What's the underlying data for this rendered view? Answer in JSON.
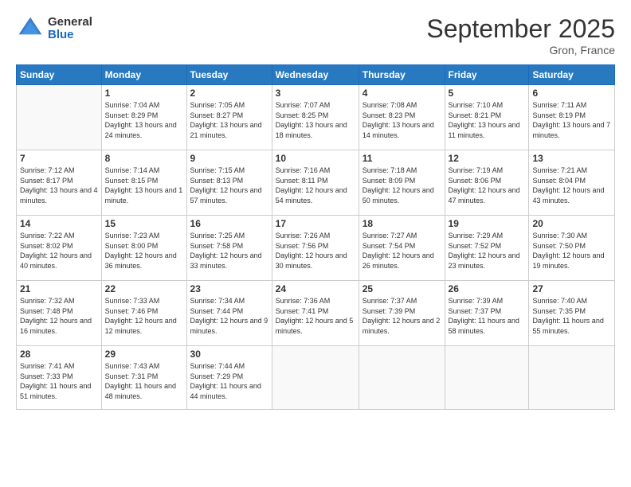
{
  "header": {
    "logo_general": "General",
    "logo_blue": "Blue",
    "month_title": "September 2025",
    "location": "Gron, France"
  },
  "days_of_week": [
    "Sunday",
    "Monday",
    "Tuesday",
    "Wednesday",
    "Thursday",
    "Friday",
    "Saturday"
  ],
  "weeks": [
    [
      {
        "day": "",
        "sunrise": "",
        "sunset": "",
        "daylight": ""
      },
      {
        "day": "1",
        "sunrise": "Sunrise: 7:04 AM",
        "sunset": "Sunset: 8:29 PM",
        "daylight": "Daylight: 13 hours and 24 minutes."
      },
      {
        "day": "2",
        "sunrise": "Sunrise: 7:05 AM",
        "sunset": "Sunset: 8:27 PM",
        "daylight": "Daylight: 13 hours and 21 minutes."
      },
      {
        "day": "3",
        "sunrise": "Sunrise: 7:07 AM",
        "sunset": "Sunset: 8:25 PM",
        "daylight": "Daylight: 13 hours and 18 minutes."
      },
      {
        "day": "4",
        "sunrise": "Sunrise: 7:08 AM",
        "sunset": "Sunset: 8:23 PM",
        "daylight": "Daylight: 13 hours and 14 minutes."
      },
      {
        "day": "5",
        "sunrise": "Sunrise: 7:10 AM",
        "sunset": "Sunset: 8:21 PM",
        "daylight": "Daylight: 13 hours and 11 minutes."
      },
      {
        "day": "6",
        "sunrise": "Sunrise: 7:11 AM",
        "sunset": "Sunset: 8:19 PM",
        "daylight": "Daylight: 13 hours and 7 minutes."
      }
    ],
    [
      {
        "day": "7",
        "sunrise": "Sunrise: 7:12 AM",
        "sunset": "Sunset: 8:17 PM",
        "daylight": "Daylight: 13 hours and 4 minutes."
      },
      {
        "day": "8",
        "sunrise": "Sunrise: 7:14 AM",
        "sunset": "Sunset: 8:15 PM",
        "daylight": "Daylight: 13 hours and 1 minute."
      },
      {
        "day": "9",
        "sunrise": "Sunrise: 7:15 AM",
        "sunset": "Sunset: 8:13 PM",
        "daylight": "Daylight: 12 hours and 57 minutes."
      },
      {
        "day": "10",
        "sunrise": "Sunrise: 7:16 AM",
        "sunset": "Sunset: 8:11 PM",
        "daylight": "Daylight: 12 hours and 54 minutes."
      },
      {
        "day": "11",
        "sunrise": "Sunrise: 7:18 AM",
        "sunset": "Sunset: 8:09 PM",
        "daylight": "Daylight: 12 hours and 50 minutes."
      },
      {
        "day": "12",
        "sunrise": "Sunrise: 7:19 AM",
        "sunset": "Sunset: 8:06 PM",
        "daylight": "Daylight: 12 hours and 47 minutes."
      },
      {
        "day": "13",
        "sunrise": "Sunrise: 7:21 AM",
        "sunset": "Sunset: 8:04 PM",
        "daylight": "Daylight: 12 hours and 43 minutes."
      }
    ],
    [
      {
        "day": "14",
        "sunrise": "Sunrise: 7:22 AM",
        "sunset": "Sunset: 8:02 PM",
        "daylight": "Daylight: 12 hours and 40 minutes."
      },
      {
        "day": "15",
        "sunrise": "Sunrise: 7:23 AM",
        "sunset": "Sunset: 8:00 PM",
        "daylight": "Daylight: 12 hours and 36 minutes."
      },
      {
        "day": "16",
        "sunrise": "Sunrise: 7:25 AM",
        "sunset": "Sunset: 7:58 PM",
        "daylight": "Daylight: 12 hours and 33 minutes."
      },
      {
        "day": "17",
        "sunrise": "Sunrise: 7:26 AM",
        "sunset": "Sunset: 7:56 PM",
        "daylight": "Daylight: 12 hours and 30 minutes."
      },
      {
        "day": "18",
        "sunrise": "Sunrise: 7:27 AM",
        "sunset": "Sunset: 7:54 PM",
        "daylight": "Daylight: 12 hours and 26 minutes."
      },
      {
        "day": "19",
        "sunrise": "Sunrise: 7:29 AM",
        "sunset": "Sunset: 7:52 PM",
        "daylight": "Daylight: 12 hours and 23 minutes."
      },
      {
        "day": "20",
        "sunrise": "Sunrise: 7:30 AM",
        "sunset": "Sunset: 7:50 PM",
        "daylight": "Daylight: 12 hours and 19 minutes."
      }
    ],
    [
      {
        "day": "21",
        "sunrise": "Sunrise: 7:32 AM",
        "sunset": "Sunset: 7:48 PM",
        "daylight": "Daylight: 12 hours and 16 minutes."
      },
      {
        "day": "22",
        "sunrise": "Sunrise: 7:33 AM",
        "sunset": "Sunset: 7:46 PM",
        "daylight": "Daylight: 12 hours and 12 minutes."
      },
      {
        "day": "23",
        "sunrise": "Sunrise: 7:34 AM",
        "sunset": "Sunset: 7:44 PM",
        "daylight": "Daylight: 12 hours and 9 minutes."
      },
      {
        "day": "24",
        "sunrise": "Sunrise: 7:36 AM",
        "sunset": "Sunset: 7:41 PM",
        "daylight": "Daylight: 12 hours and 5 minutes."
      },
      {
        "day": "25",
        "sunrise": "Sunrise: 7:37 AM",
        "sunset": "Sunset: 7:39 PM",
        "daylight": "Daylight: 12 hours and 2 minutes."
      },
      {
        "day": "26",
        "sunrise": "Sunrise: 7:39 AM",
        "sunset": "Sunset: 7:37 PM",
        "daylight": "Daylight: 11 hours and 58 minutes."
      },
      {
        "day": "27",
        "sunrise": "Sunrise: 7:40 AM",
        "sunset": "Sunset: 7:35 PM",
        "daylight": "Daylight: 11 hours and 55 minutes."
      }
    ],
    [
      {
        "day": "28",
        "sunrise": "Sunrise: 7:41 AM",
        "sunset": "Sunset: 7:33 PM",
        "daylight": "Daylight: 11 hours and 51 minutes."
      },
      {
        "day": "29",
        "sunrise": "Sunrise: 7:43 AM",
        "sunset": "Sunset: 7:31 PM",
        "daylight": "Daylight: 11 hours and 48 minutes."
      },
      {
        "day": "30",
        "sunrise": "Sunrise: 7:44 AM",
        "sunset": "Sunset: 7:29 PM",
        "daylight": "Daylight: 11 hours and 44 minutes."
      },
      {
        "day": "",
        "sunrise": "",
        "sunset": "",
        "daylight": ""
      },
      {
        "day": "",
        "sunrise": "",
        "sunset": "",
        "daylight": ""
      },
      {
        "day": "",
        "sunrise": "",
        "sunset": "",
        "daylight": ""
      },
      {
        "day": "",
        "sunrise": "",
        "sunset": "",
        "daylight": ""
      }
    ]
  ]
}
